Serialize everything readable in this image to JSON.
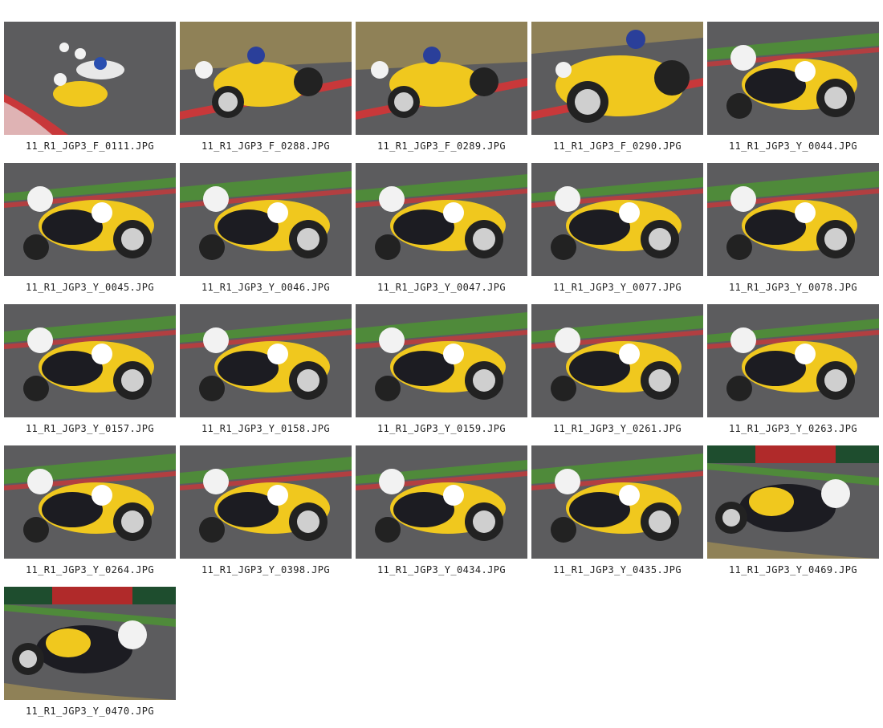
{
  "gallery": {
    "items": [
      {
        "filename": "11_R1_JGP3_F_0111.JPG",
        "scene": "pack"
      },
      {
        "filename": "11_R1_JGP3_F_0288.JPG",
        "scene": "front"
      },
      {
        "filename": "11_R1_JGP3_F_0289.JPG",
        "scene": "front"
      },
      {
        "filename": "11_R1_JGP3_F_0290.JPG",
        "scene": "front-close"
      },
      {
        "filename": "11_R1_JGP3_Y_0044.JPG",
        "scene": "side"
      },
      {
        "filename": "11_R1_JGP3_Y_0045.JPG",
        "scene": "side"
      },
      {
        "filename": "11_R1_JGP3_Y_0046.JPG",
        "scene": "side"
      },
      {
        "filename": "11_R1_JGP3_Y_0047.JPG",
        "scene": "side"
      },
      {
        "filename": "11_R1_JGP3_Y_0077.JPG",
        "scene": "side"
      },
      {
        "filename": "11_R1_JGP3_Y_0078.JPG",
        "scene": "side"
      },
      {
        "filename": "11_R1_JGP3_Y_0157.JPG",
        "scene": "side"
      },
      {
        "filename": "11_R1_JGP3_Y_0158.JPG",
        "scene": "side"
      },
      {
        "filename": "11_R1_JGP3_Y_0159.JPG",
        "scene": "side"
      },
      {
        "filename": "11_R1_JGP3_Y_0261.JPG",
        "scene": "side"
      },
      {
        "filename": "11_R1_JGP3_Y_0263.JPG",
        "scene": "side"
      },
      {
        "filename": "11_R1_JGP3_Y_0264.JPG",
        "scene": "side"
      },
      {
        "filename": "11_R1_JGP3_Y_0398.JPG",
        "scene": "side"
      },
      {
        "filename": "11_R1_JGP3_Y_0434.JPG",
        "scene": "side"
      },
      {
        "filename": "11_R1_JGP3_Y_0435.JPG",
        "scene": "side"
      },
      {
        "filename": "11_R1_JGP3_Y_0469.JPG",
        "scene": "rear"
      },
      {
        "filename": "11_R1_JGP3_Y_0470.JPG",
        "scene": "rear"
      }
    ]
  },
  "colors": {
    "asphalt": "#5c5c5e",
    "grass": "#4f8a3a",
    "dry_grass": "#8f8157",
    "kerb_red": "#c8383a",
    "bike_yellow": "#f0c81e",
    "leathers": "#1c1c22",
    "helmet": "#f2f2f2"
  }
}
